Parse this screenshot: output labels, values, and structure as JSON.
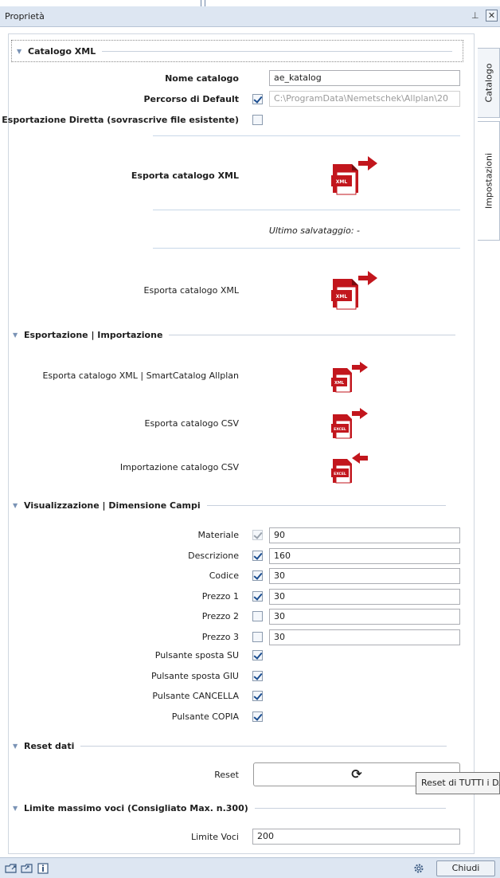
{
  "window": {
    "title": "Proprietà",
    "pin_glyph": "⊥",
    "close_glyph": "✕"
  },
  "tabs": [
    {
      "label": "Catalogo"
    },
    {
      "label": "Impostazioni"
    }
  ],
  "catalogo_xml": {
    "header": "Catalogo XML",
    "nome_catalogo_label": "Nome catalogo",
    "nome_catalogo_value": "ae_katalog",
    "percorso_label": "Percorso di Default",
    "percorso_checked": true,
    "percorso_value": "C:\\ProgramData\\Nemetschek\\Allplan\\20",
    "esportazione_diretta_label": "Esportazione Diretta (sovrascrive file esistente)",
    "esportazione_diretta_checked": false,
    "esporta_bold_label": "Esporta catalogo XML",
    "ultimo_salvataggio": "Ultimo salvataggio: -",
    "esporta_label": "Esporta catalogo XML",
    "xml_icon_text": "XML"
  },
  "esportazione_importazione": {
    "header": "Esportazione | Importazione",
    "rows": [
      {
        "label": "Esporta catalogo XML | SmartCatalog Allplan",
        "icon_text": "XML"
      },
      {
        "label": "Esporta catalogo CSV",
        "icon_text": "EXCEL"
      },
      {
        "label": "Importazione catalogo CSV",
        "icon_text": "EXCEL"
      }
    ]
  },
  "visualizzazione": {
    "header": "Visualizzazione | Dimensione Campi",
    "fields": [
      {
        "label": "Materiale",
        "checked": true,
        "disabled": true,
        "value": "90"
      },
      {
        "label": "Descrizione",
        "checked": true,
        "disabled": false,
        "value": "160"
      },
      {
        "label": "Codice",
        "checked": true,
        "disabled": false,
        "value": "30"
      },
      {
        "label": "Prezzo 1",
        "checked": true,
        "disabled": false,
        "value": "30"
      },
      {
        "label": "Prezzo 2",
        "checked": false,
        "disabled": false,
        "value": "30"
      },
      {
        "label": "Prezzo 3",
        "checked": false,
        "disabled": false,
        "value": "30"
      }
    ],
    "buttons": [
      {
        "label": "Pulsante sposta SU",
        "checked": true
      },
      {
        "label": "Pulsante sposta GIU",
        "checked": true
      },
      {
        "label": "Pulsante CANCELLA",
        "checked": true
      },
      {
        "label": "Pulsante COPIA",
        "checked": true
      }
    ]
  },
  "reset": {
    "header": "Reset dati",
    "label": "Reset",
    "button_glyph": "⟳",
    "tooltip": "Reset di TUTTI i DA"
  },
  "limite": {
    "header": "Limite massimo voci (Consigliato Max. n.300)",
    "label": "Limite Voci",
    "value": "200"
  },
  "footer": {
    "close_label": "Chiudi",
    "icons": [
      "open-folder-icon",
      "export-icon",
      "info-icon",
      "gear-icon"
    ]
  },
  "colors": {
    "accent": "#1d4f91",
    "file_red": "#c2161d",
    "titlebar": "#dde6f2"
  }
}
